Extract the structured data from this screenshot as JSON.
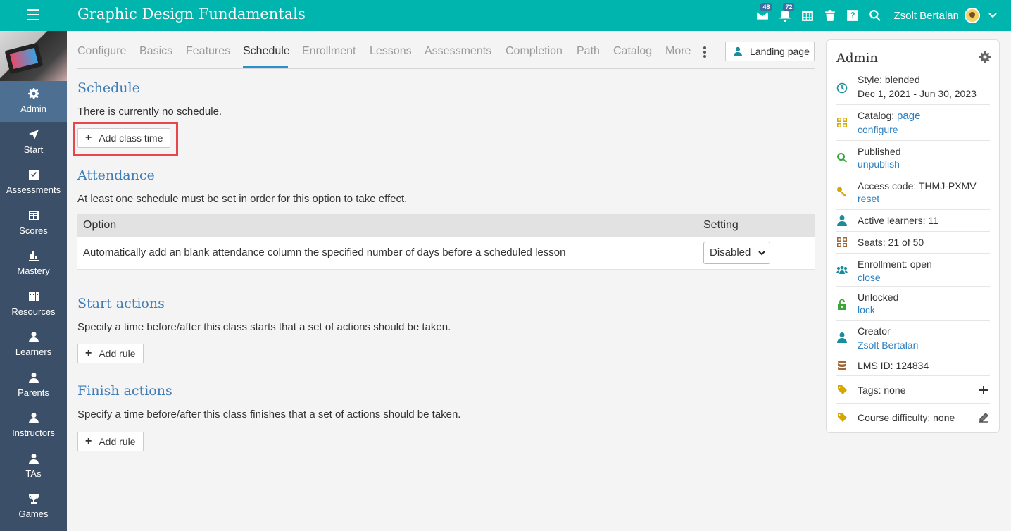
{
  "header": {
    "title": "Graphic Design Fundamentals",
    "messages_badge": "48",
    "notifications_badge": "72",
    "user_name": "Zsolt Bertalan"
  },
  "sidebar": {
    "items": [
      {
        "label": "Admin",
        "icon": "gear-icon"
      },
      {
        "label": "Start",
        "icon": "arrow-icon"
      },
      {
        "label": "Assessments",
        "icon": "checkbox-icon"
      },
      {
        "label": "Scores",
        "icon": "gradebook-icon"
      },
      {
        "label": "Mastery",
        "icon": "bar-chart-icon"
      },
      {
        "label": "Resources",
        "icon": "books-icon"
      },
      {
        "label": "Learners",
        "icon": "person-icon"
      },
      {
        "label": "Parents",
        "icon": "person-icon"
      },
      {
        "label": "Instructors",
        "icon": "person-icon"
      },
      {
        "label": "TAs",
        "icon": "person-icon"
      },
      {
        "label": "Games",
        "icon": "trophy-icon"
      }
    ]
  },
  "tabs": {
    "items": [
      "Configure",
      "Basics",
      "Features",
      "Schedule",
      "Enrollment",
      "Lessons",
      "Assessments",
      "Completion",
      "Path",
      "Catalog",
      "More"
    ],
    "active": "Schedule",
    "landing_page": "Landing page"
  },
  "schedule": {
    "title": "Schedule",
    "text": "There is currently no schedule.",
    "add_button": "Add class time"
  },
  "attendance": {
    "title": "Attendance",
    "text": "At least one schedule must be set in order for this option to take effect.",
    "col_option": "Option",
    "col_setting": "Setting",
    "row_desc": "Automatically add an blank attendance column the specified number of days before a scheduled lesson",
    "row_value": "Disabled"
  },
  "start_actions": {
    "title": "Start actions",
    "text": "Specify a time before/after this class starts that a set of actions should be taken.",
    "add_button": "Add rule"
  },
  "finish_actions": {
    "title": "Finish actions",
    "text": "Specify a time before/after this class finishes that a set of actions should be taken.",
    "add_button": "Add rule"
  },
  "panel": {
    "title": "Admin",
    "style_label": "Style: blended",
    "style_dates": "Dec 1, 2021 - Jun 30, 2023",
    "catalog_label": "Catalog:",
    "catalog_link": "page",
    "catalog_configure": "configure",
    "published_label": "Published",
    "published_link": "unpublish",
    "access_label": "Access code: THMJ-PXMV",
    "access_link": "reset",
    "active_learners": "Active learners: 11",
    "seats": "Seats: 21 of 50",
    "enrollment_label": "Enrollment: open",
    "enrollment_link": "close",
    "unlocked_label": "Unlocked",
    "unlocked_link": "lock",
    "creator_label": "Creator",
    "creator_link": "Zsolt Bertalan",
    "lms_id": "LMS ID: 124834",
    "tags": "Tags: none",
    "difficulty": "Course difficulty: none"
  },
  "colors": {
    "topbar": "#00b5ad",
    "sidebar": "#3b5068",
    "sidebar_active": "#4c6f92",
    "link": "#2c7fc0",
    "section_title": "#3f7db8",
    "highlight": "#e8464a"
  }
}
